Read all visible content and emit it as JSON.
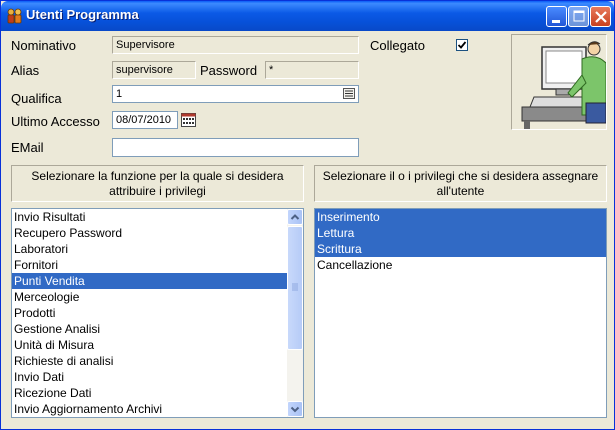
{
  "window": {
    "title": "Utenti Programma",
    "icon": "user-group-icon"
  },
  "form": {
    "nominativo_label": "Nominativo",
    "nominativo_value": "Supervisore",
    "collegato_label": "Collegato",
    "collegato_checked": true,
    "alias_label": "Alias",
    "alias_value": "supervisore",
    "password_label": "Password",
    "password_value": "*",
    "qualifica_label": "Qualifica",
    "qualifica_value": "1",
    "ultimo_accesso_label": "Ultimo Accesso",
    "ultimo_accesso_value": "08/07/2010",
    "email_label": "EMail",
    "email_value": ""
  },
  "functions_panel": {
    "header": "Selezionare la funzione per la quale si desidera attribuire i privilegi",
    "items": [
      "Invio Risultati",
      "Recupero Password",
      "Laboratori",
      "Fornitori",
      "Punti Vendita",
      "Merceologie",
      "Prodotti",
      "Gestione Analisi",
      "Unità di Misura",
      "Richieste di analisi",
      "Invio Dati",
      "Ricezione Dati",
      "Invio Aggiornamento Archivi"
    ],
    "selected_index": 4
  },
  "privileges_panel": {
    "header": "Selezionare il o i privilegi che si desidera assegnare all'utente",
    "items": [
      "Inserimento",
      "Lettura",
      "Scrittura",
      "Cancellazione"
    ],
    "selected": [
      0,
      1,
      2
    ]
  },
  "colors": {
    "titlebar": "#0751d9",
    "selection": "#316ac5",
    "face": "#ece9d8"
  }
}
